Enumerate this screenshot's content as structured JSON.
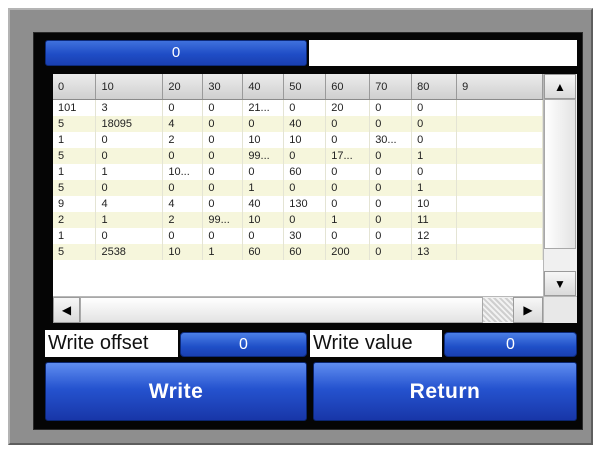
{
  "header": {
    "counter_value": "0"
  },
  "table": {
    "columns": [
      "0",
      "10",
      "20",
      "30",
      "40",
      "50",
      "60",
      "70",
      "80",
      "9"
    ],
    "rows": [
      [
        "101",
        "3",
        "0",
        "0",
        "21...",
        "0",
        "20",
        "0",
        "0",
        ""
      ],
      [
        "5",
        "18095",
        "4",
        "0",
        "0",
        "40",
        "0",
        "0",
        "0",
        ""
      ],
      [
        "1",
        "0",
        "2",
        "0",
        "10",
        "10",
        "0",
        "30...",
        "0",
        ""
      ],
      [
        "5",
        "0",
        "0",
        "0",
        "99...",
        "0",
        "17...",
        "0",
        "1",
        ""
      ],
      [
        "1",
        "1",
        "10...",
        "0",
        "0",
        "60",
        "0",
        "0",
        "0",
        ""
      ],
      [
        "5",
        "0",
        "0",
        "0",
        "1",
        "0",
        "0",
        "0",
        "1",
        ""
      ],
      [
        "9",
        "4",
        "4",
        "0",
        "40",
        "130",
        "0",
        "0",
        "10",
        ""
      ],
      [
        "2",
        "1",
        "2",
        "99...",
        "10",
        "0",
        "1",
        "0",
        "11",
        ""
      ],
      [
        "1",
        "0",
        "0",
        "0",
        "0",
        "30",
        "0",
        "0",
        "12",
        ""
      ],
      [
        "5",
        "2538",
        "10",
        "1",
        "60",
        "60",
        "200",
        "0",
        "13",
        ""
      ]
    ]
  },
  "scrollbar": {
    "up_icon": "▲",
    "down_icon": "▼",
    "left_icon": "◀",
    "right_icon": "▶"
  },
  "write_row": {
    "offset_label": "Write offset",
    "offset_value": "0",
    "value_label": "Write value",
    "value_value": "0"
  },
  "buttons": {
    "write": "Write",
    "return": "Return"
  },
  "colors": {
    "accent_blue": "#1f4fc7",
    "row_alt": "#f6f6dc",
    "bezel": "#8e8e8e"
  }
}
